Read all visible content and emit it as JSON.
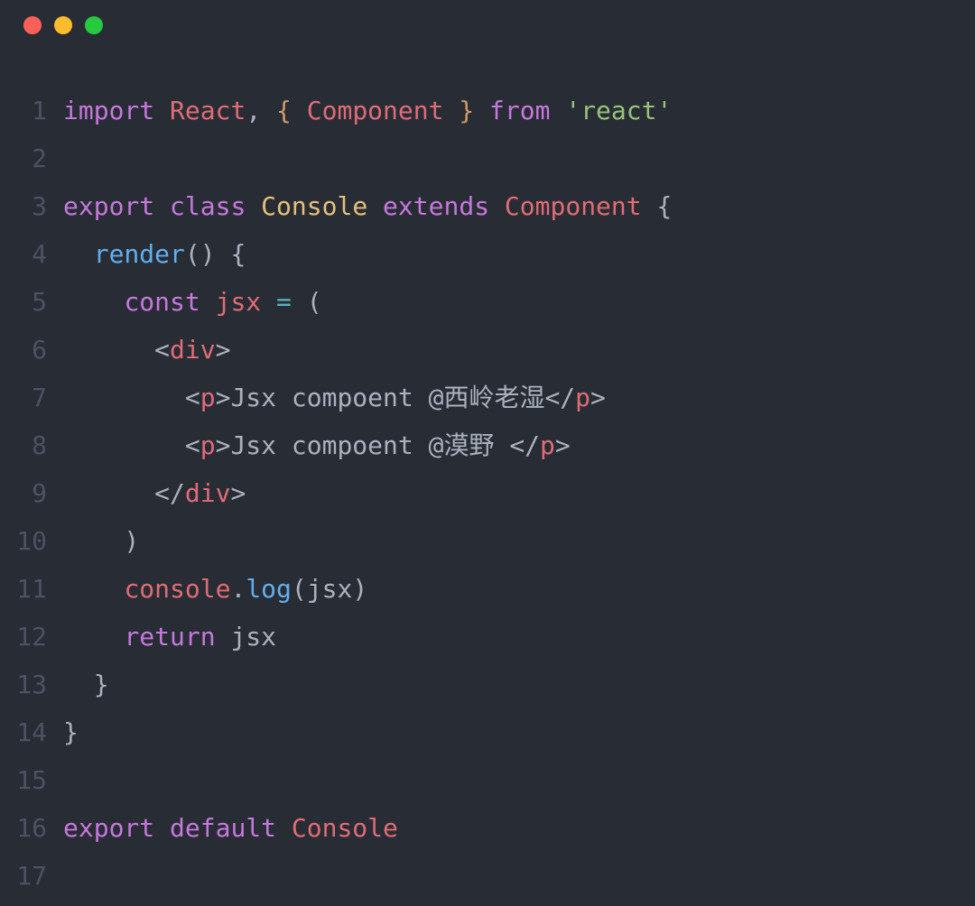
{
  "window_controls": {
    "close": "#ff5f56",
    "minimize": "#ffbd2e",
    "zoom": "#27c93f"
  },
  "code": {
    "lines": [
      {
        "num": "1",
        "tokens": [
          {
            "t": "import ",
            "c": "kw"
          },
          {
            "t": "React",
            "c": "ident"
          },
          {
            "t": ", ",
            "c": "plain"
          },
          {
            "t": "{ ",
            "c": "brackt"
          },
          {
            "t": "Component",
            "c": "ident"
          },
          {
            "t": " }",
            "c": "brackt"
          },
          {
            "t": " from ",
            "c": "kw"
          },
          {
            "t": "'react'",
            "c": "str"
          }
        ]
      },
      {
        "num": "2",
        "tokens": []
      },
      {
        "num": "3",
        "tokens": [
          {
            "t": "export ",
            "c": "kw"
          },
          {
            "t": "class ",
            "c": "kw"
          },
          {
            "t": "Console",
            "c": "cls"
          },
          {
            "t": " extends ",
            "c": "kw"
          },
          {
            "t": "Component",
            "c": "ident"
          },
          {
            "t": " {",
            "c": "plain"
          }
        ]
      },
      {
        "num": "4",
        "tokens": [
          {
            "t": "  ",
            "c": "plain"
          },
          {
            "t": "render",
            "c": "fn"
          },
          {
            "t": "() {",
            "c": "plain"
          }
        ]
      },
      {
        "num": "5",
        "tokens": [
          {
            "t": "    ",
            "c": "plain"
          },
          {
            "t": "const ",
            "c": "kw"
          },
          {
            "t": "jsx",
            "c": "ident"
          },
          {
            "t": " ",
            "c": "plain"
          },
          {
            "t": "=",
            "c": "op"
          },
          {
            "t": " (",
            "c": "plain"
          }
        ]
      },
      {
        "num": "6",
        "tokens": [
          {
            "t": "      ",
            "c": "plain"
          },
          {
            "t": "<",
            "c": "plain"
          },
          {
            "t": "div",
            "c": "tag"
          },
          {
            "t": ">",
            "c": "plain"
          }
        ]
      },
      {
        "num": "7",
        "tokens": [
          {
            "t": "        ",
            "c": "plain"
          },
          {
            "t": "<",
            "c": "plain"
          },
          {
            "t": "p",
            "c": "tag"
          },
          {
            "t": ">",
            "c": "plain"
          },
          {
            "t": "Jsx compoent @西岭老湿",
            "c": "plain"
          },
          {
            "t": "</",
            "c": "plain"
          },
          {
            "t": "p",
            "c": "tag"
          },
          {
            "t": ">",
            "c": "plain"
          }
        ]
      },
      {
        "num": "8",
        "tokens": [
          {
            "t": "        ",
            "c": "plain"
          },
          {
            "t": "<",
            "c": "plain"
          },
          {
            "t": "p",
            "c": "tag"
          },
          {
            "t": ">",
            "c": "plain"
          },
          {
            "t": "Jsx compoent @漠野 ",
            "c": "plain"
          },
          {
            "t": "</",
            "c": "plain"
          },
          {
            "t": "p",
            "c": "tag"
          },
          {
            "t": ">",
            "c": "plain"
          }
        ]
      },
      {
        "num": "9",
        "tokens": [
          {
            "t": "      ",
            "c": "plain"
          },
          {
            "t": "</",
            "c": "plain"
          },
          {
            "t": "div",
            "c": "tag"
          },
          {
            "t": ">",
            "c": "plain"
          }
        ]
      },
      {
        "num": "10",
        "tokens": [
          {
            "t": "    )",
            "c": "plain"
          }
        ]
      },
      {
        "num": "11",
        "tokens": [
          {
            "t": "    ",
            "c": "plain"
          },
          {
            "t": "console",
            "c": "ident"
          },
          {
            "t": ".",
            "c": "plain"
          },
          {
            "t": "log",
            "c": "fn"
          },
          {
            "t": "(",
            "c": "plain"
          },
          {
            "t": "jsx",
            "c": "plain"
          },
          {
            "t": ")",
            "c": "plain"
          }
        ]
      },
      {
        "num": "12",
        "tokens": [
          {
            "t": "    ",
            "c": "plain"
          },
          {
            "t": "return ",
            "c": "kw"
          },
          {
            "t": "jsx",
            "c": "plain"
          }
        ]
      },
      {
        "num": "13",
        "tokens": [
          {
            "t": "  }",
            "c": "plain"
          }
        ]
      },
      {
        "num": "14",
        "tokens": [
          {
            "t": "}",
            "c": "plain"
          }
        ]
      },
      {
        "num": "15",
        "tokens": []
      },
      {
        "num": "16",
        "tokens": [
          {
            "t": "export ",
            "c": "kw"
          },
          {
            "t": "default ",
            "c": "kw"
          },
          {
            "t": "Console",
            "c": "ident"
          }
        ]
      },
      {
        "num": "17",
        "tokens": []
      }
    ]
  }
}
